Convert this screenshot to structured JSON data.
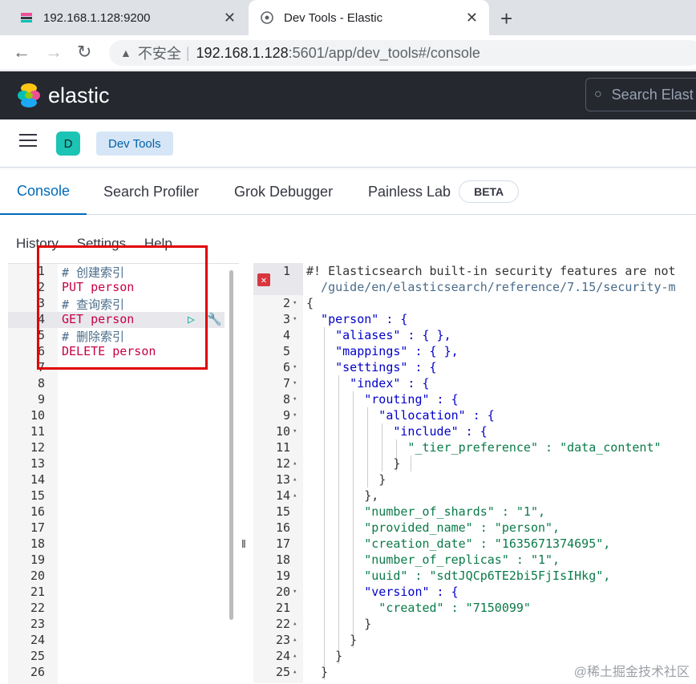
{
  "browser": {
    "tabs": [
      {
        "title": "192.168.1.128:9200"
      },
      {
        "title": "Dev Tools - Elastic"
      }
    ],
    "new_tab": "+",
    "close": "✕",
    "nav": {
      "back": "←",
      "forward": "→",
      "reload": "↻"
    },
    "address": {
      "insecure": "不安全",
      "host": "192.168.1.128",
      "path": ":5601/app/dev_tools#/console"
    }
  },
  "header": {
    "brand": "elastic",
    "search_placeholder": "Search Elast"
  },
  "breadcrumb": {
    "avatar": "D",
    "crumb": "Dev Tools"
  },
  "tabs": [
    "Console",
    "Search Profiler",
    "Grok Debugger",
    "Painless Lab"
  ],
  "beta": "BETA",
  "menu": [
    "History",
    "Settings",
    "Help"
  ],
  "editor": {
    "lines": [
      {
        "n": "1",
        "t": "# 创建索引",
        "cls": "c"
      },
      {
        "n": "2",
        "t": "PUT person",
        "cls": "m"
      },
      {
        "n": "3",
        "t": "# 查询索引",
        "cls": "c"
      },
      {
        "n": "4",
        "t": "GET person",
        "cls": "m"
      },
      {
        "n": "5",
        "t": "# 删除索引",
        "cls": "c"
      },
      {
        "n": "6",
        "t": "DELETE person",
        "cls": "m"
      },
      {
        "n": "7",
        "t": ""
      },
      {
        "n": "8",
        "t": ""
      },
      {
        "n": "9",
        "t": ""
      },
      {
        "n": "10",
        "t": ""
      },
      {
        "n": "11",
        "t": ""
      },
      {
        "n": "12",
        "t": ""
      },
      {
        "n": "13",
        "t": ""
      },
      {
        "n": "14",
        "t": ""
      },
      {
        "n": "15",
        "t": ""
      },
      {
        "n": "16",
        "t": ""
      },
      {
        "n": "17",
        "t": ""
      },
      {
        "n": "18",
        "t": ""
      },
      {
        "n": "19",
        "t": ""
      },
      {
        "n": "20",
        "t": ""
      },
      {
        "n": "21",
        "t": ""
      },
      {
        "n": "22",
        "t": ""
      },
      {
        "n": "23",
        "t": ""
      },
      {
        "n": "24",
        "t": ""
      },
      {
        "n": "25",
        "t": ""
      },
      {
        "n": "26",
        "t": ""
      }
    ]
  },
  "output": {
    "lines": [
      {
        "n": "1",
        "t": "#! Elasticsearch built-in security features are not",
        "cls": "u",
        "fold": ""
      },
      {
        "n": "",
        "t": "  /guide/en/elasticsearch/reference/7.15/security-m",
        "cls": "c",
        "fold": ""
      },
      {
        "n": "2",
        "t": "{",
        "cls": "p",
        "fold": "▾"
      },
      {
        "n": "3",
        "t": "  \"person\" : {",
        "cls": "k",
        "fold": "▾"
      },
      {
        "n": "4",
        "t": "    \"aliases\" : { },",
        "cls": "k",
        "fold": ""
      },
      {
        "n": "5",
        "t": "    \"mappings\" : { },",
        "cls": "k",
        "fold": ""
      },
      {
        "n": "6",
        "t": "    \"settings\" : {",
        "cls": "k",
        "fold": "▾"
      },
      {
        "n": "7",
        "t": "      \"index\" : {",
        "cls": "k",
        "fold": "▾"
      },
      {
        "n": "8",
        "t": "        \"routing\" : {",
        "cls": "k",
        "fold": "▾"
      },
      {
        "n": "9",
        "t": "          \"allocation\" : {",
        "cls": "k",
        "fold": "▾"
      },
      {
        "n": "10",
        "t": "            \"include\" : {",
        "cls": "k",
        "fold": "▾"
      },
      {
        "n": "11",
        "t": "              \"_tier_preference\" : \"data_content\"",
        "cls": "s",
        "fold": ""
      },
      {
        "n": "12",
        "t": "            }",
        "cls": "p",
        "fold": "▴"
      },
      {
        "n": "13",
        "t": "          }",
        "cls": "p",
        "fold": "▴"
      },
      {
        "n": "14",
        "t": "        },",
        "cls": "p",
        "fold": "▴"
      },
      {
        "n": "15",
        "t": "        \"number_of_shards\" : \"1\",",
        "cls": "s",
        "fold": ""
      },
      {
        "n": "16",
        "t": "        \"provided_name\" : \"person\",",
        "cls": "s",
        "fold": ""
      },
      {
        "n": "17",
        "t": "        \"creation_date\" : \"1635671374695\",",
        "cls": "s",
        "fold": ""
      },
      {
        "n": "18",
        "t": "        \"number_of_replicas\" : \"1\",",
        "cls": "s",
        "fold": ""
      },
      {
        "n": "19",
        "t": "        \"uuid\" : \"sdtJQCp6TE2bi5FjIsIHkg\",",
        "cls": "s",
        "fold": ""
      },
      {
        "n": "20",
        "t": "        \"version\" : {",
        "cls": "k",
        "fold": "▾"
      },
      {
        "n": "21",
        "t": "          \"created\" : \"7150099\"",
        "cls": "s",
        "fold": ""
      },
      {
        "n": "22",
        "t": "        }",
        "cls": "p",
        "fold": "▴"
      },
      {
        "n": "23",
        "t": "      }",
        "cls": "p",
        "fold": "▴"
      },
      {
        "n": "24",
        "t": "    }",
        "cls": "p",
        "fold": "▴"
      },
      {
        "n": "25",
        "t": "  }",
        "cls": "p",
        "fold": "▴"
      }
    ]
  },
  "watermark": "@稀土掘金技术社区",
  "colors": {
    "accent": "#006bb8",
    "highlight_box": "#e00000",
    "header_bg": "#25282f"
  }
}
